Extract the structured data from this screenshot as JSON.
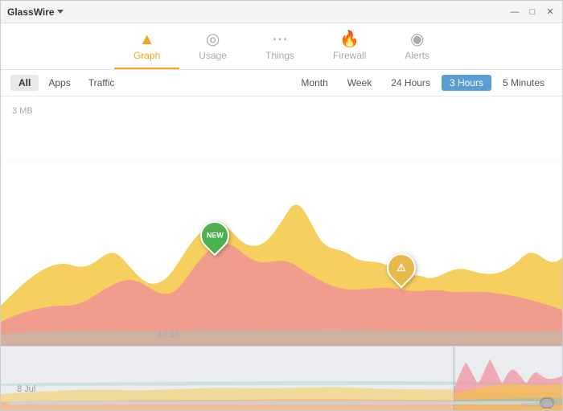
{
  "titleBar": {
    "appName": "GlassWire",
    "dropdownChevron": "▾",
    "minBtn": "—",
    "maxBtn": "□",
    "closeBtn": "✕"
  },
  "navTabs": [
    {
      "id": "graph",
      "label": "Graph",
      "icon": "▲",
      "active": true
    },
    {
      "id": "usage",
      "label": "Usage",
      "icon": "◎",
      "active": false
    },
    {
      "id": "things",
      "label": "Things",
      "icon": "⋯",
      "active": false
    },
    {
      "id": "firewall",
      "label": "Firewall",
      "icon": "🔥",
      "active": false
    },
    {
      "id": "alerts",
      "label": "Alerts",
      "icon": "◉",
      "active": false
    }
  ],
  "subToolbar": {
    "filters": [
      {
        "id": "all",
        "label": "All",
        "active": true
      },
      {
        "id": "apps",
        "label": "Apps",
        "active": false
      },
      {
        "id": "traffic",
        "label": "Traffic",
        "active": false
      }
    ],
    "timeFilters": [
      {
        "id": "month",
        "label": "Month",
        "active": false
      },
      {
        "id": "week",
        "label": "Week",
        "active": false
      },
      {
        "id": "24hours",
        "label": "24 Hours",
        "active": false
      },
      {
        "id": "3hours",
        "label": "3 Hours",
        "active": true
      },
      {
        "id": "5minutes",
        "label": "5 Minutes",
        "active": false
      }
    ]
  },
  "mainChart": {
    "yLabel": "3 MB",
    "xLabel": "10:15",
    "pin1Label": "NEW",
    "pin2Label": "⚠"
  },
  "miniChart": {
    "dateLabel": "8 Jul"
  },
  "watermark": "wsxdn.com"
}
